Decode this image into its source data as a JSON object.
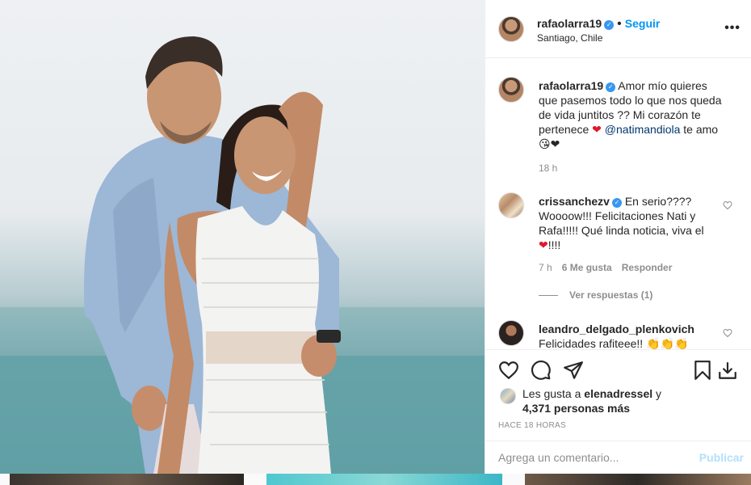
{
  "post": {
    "author": "rafaolarra19",
    "follow_label": "Seguir",
    "location": "Santiago, Chile",
    "caption": {
      "username": "rafaolarra19",
      "text_1": "Amor mío quieres que pasemos todo lo que nos queda de vida juntitos ?? Mi corazón te pertenece",
      "heart": "❤",
      "mention": "@natimandiola",
      "text_2": "te amo",
      "emojis": "😘❤",
      "time": "18 h"
    }
  },
  "comments": [
    {
      "username": "crissanchezv",
      "text_1": "En serio???? Woooow!!! Felicitaciones Nati y Rafa!!!!! Qué linda noticia, viva el",
      "heart": "❤",
      "text_2": "!!!!",
      "time": "7 h",
      "likes": "6 Me gusta",
      "reply": "Responder",
      "view_replies": "Ver respuestas (1)"
    },
    {
      "username": "leandro_delgado_plenkovich",
      "text": "Felicidades rafiteee!!",
      "emojis": "👏👏👏"
    }
  ],
  "likes": {
    "prefix": "Les gusta a",
    "user": "elenadressel",
    "middle": "y",
    "count": "4,371 personas más"
  },
  "time_ago": "HACE 18 HORAS",
  "add_comment": {
    "placeholder": "Agrega un comentario...",
    "post_label": "Publicar"
  },
  "icons": {
    "more": "more-options-icon",
    "like": "heart-icon",
    "comment": "comment-icon",
    "share": "share-icon",
    "save": "bookmark-icon",
    "download": "download-icon"
  },
  "colors": {
    "link": "#0095f6",
    "verified": "#3897f0",
    "muted": "#8e8e8e",
    "heart": "#e0192d"
  }
}
